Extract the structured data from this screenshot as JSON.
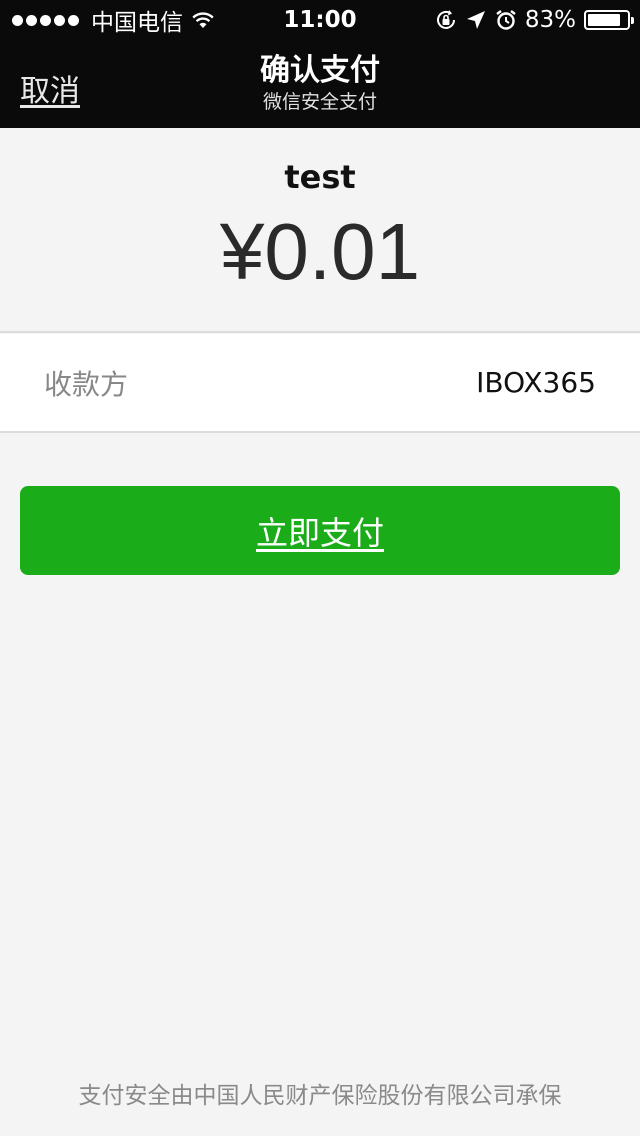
{
  "status_bar": {
    "carrier": "中国电信",
    "time": "11:00",
    "battery_percent": "83%",
    "battery_level": 0.83,
    "icons": [
      "signal-dots",
      "wifi-icon",
      "rotation-lock-icon",
      "location-icon",
      "alarm-icon",
      "battery-icon"
    ]
  },
  "nav": {
    "cancel_label": "取消",
    "title": "确认支付",
    "subtitle": "微信安全支付"
  },
  "order": {
    "product_name": "test",
    "amount": "¥0.01"
  },
  "payee": {
    "label": "收款方",
    "value": "IBOX365"
  },
  "pay_button": {
    "label": "立即支付",
    "color": "#1aad19"
  },
  "footer": {
    "note": "支付安全由中国人民财产保险股份有限公司承保"
  }
}
